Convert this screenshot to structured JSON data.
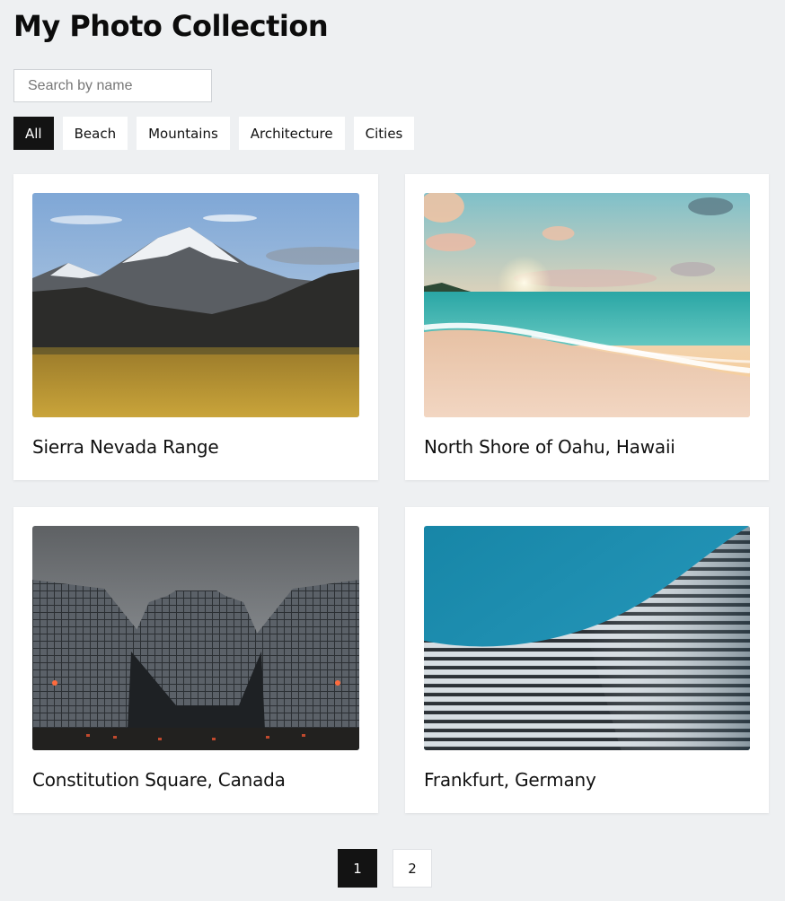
{
  "header": {
    "title": "My Photo Collection"
  },
  "search": {
    "placeholder": "Search by name",
    "value": ""
  },
  "filters": [
    {
      "label": "All",
      "active": true
    },
    {
      "label": "Beach",
      "active": false
    },
    {
      "label": "Mountains",
      "active": false
    },
    {
      "label": "Architecture",
      "active": false
    },
    {
      "label": "Cities",
      "active": false
    }
  ],
  "photos": [
    {
      "title": "Sierra Nevada Range",
      "image_icon": "mountain-photo"
    },
    {
      "title": "North Shore of Oahu, Hawaii",
      "image_icon": "beach-photo"
    },
    {
      "title": "Constitution Square, Canada",
      "image_icon": "skyscraper-photo"
    },
    {
      "title": "Frankfurt, Germany",
      "image_icon": "wave-facade-photo"
    }
  ],
  "pagination": {
    "pages": [
      "1",
      "2"
    ],
    "current": "1"
  },
  "colors": {
    "background": "#eef0f2",
    "active": "#131313",
    "card": "#ffffff"
  }
}
